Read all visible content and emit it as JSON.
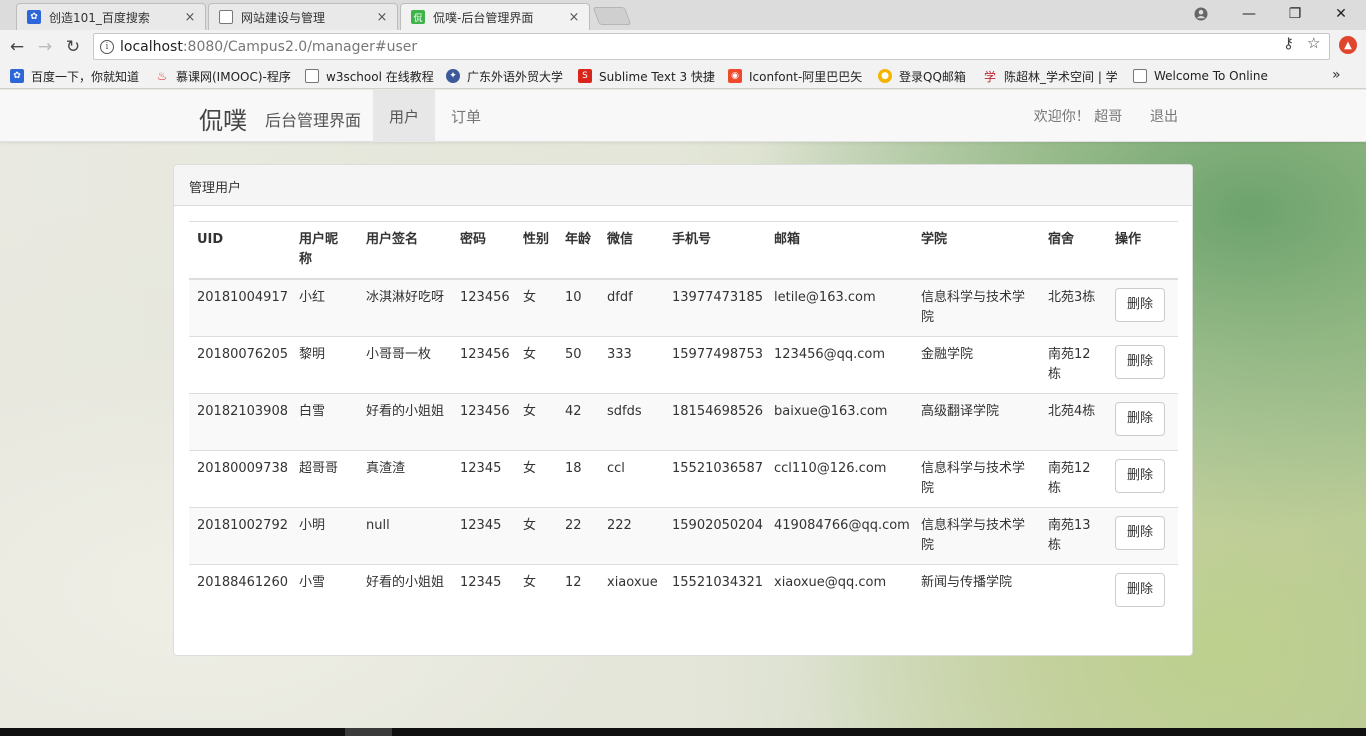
{
  "browser": {
    "tabs": [
      {
        "title": "创造101_百度搜索",
        "icon": "baidu-paw-icon",
        "close": "×"
      },
      {
        "title": "网站建设与管理",
        "icon": "page-icon",
        "close": "×"
      },
      {
        "title": "侃噗-后台管理界面",
        "icon": "site-logo-icon",
        "close": "×"
      }
    ],
    "window_controls": {
      "minimize": "—",
      "maximize": "❐",
      "close": "✕"
    },
    "url_host": "localhost",
    "url_path": ":8080/Campus2.0/manager#user",
    "bookmarks": [
      {
        "label": "百度一下，你就知道",
        "icon": "baidu-paw-icon"
      },
      {
        "label": "慕课网(IMOOC)-程序",
        "icon": "imooc-flame-icon"
      },
      {
        "label": "w3school 在线教程",
        "icon": "page-icon"
      },
      {
        "label": "广东外语外贸大学",
        "icon": "university-seal-icon"
      },
      {
        "label": "Sublime Text 3 快捷",
        "icon": "sublime-icon"
      },
      {
        "label": "Iconfont-阿里巴巴矢",
        "icon": "iconfont-icon"
      },
      {
        "label": "登录QQ邮箱",
        "icon": "qq-mail-icon"
      },
      {
        "label": "陈超林_学术空间 | 学",
        "icon": "academic-icon"
      },
      {
        "label": "Welcome To Online",
        "icon": "page-icon"
      }
    ],
    "bookmarks_more": "»"
  },
  "navbar": {
    "brand": "侃噗",
    "brand_sub": "后台管理界面",
    "items": [
      {
        "label": "用户",
        "active": true
      },
      {
        "label": "订单",
        "active": false
      }
    ],
    "welcome": "欢迎你！ 超哥",
    "logout": "退出"
  },
  "panel": {
    "title": "管理用户",
    "columns": [
      "UID",
      "用户昵称",
      "用户签名",
      "密码",
      "性别",
      "年龄",
      "微信",
      "手机号",
      "邮箱",
      "学院",
      "宿舍",
      "操作"
    ],
    "rows": [
      {
        "uid": "20181004917",
        "nickname": "小红",
        "signature": "冰淇淋好吃呀",
        "password": "123456",
        "gender": "女",
        "age": "10",
        "wechat": "dfdf",
        "phone": "13977473185",
        "email": "letile@163.com",
        "college": "信息科学与技术学院",
        "dorm": "北苑3栋",
        "action": "删除"
      },
      {
        "uid": "20180076205",
        "nickname": "黎明",
        "signature": "小哥哥一枚",
        "password": "123456",
        "gender": "女",
        "age": "50",
        "wechat": "333",
        "phone": "15977498753",
        "email": "123456@qq.com",
        "college": "金融学院",
        "dorm": "南苑12栋",
        "action": "删除"
      },
      {
        "uid": "20182103908",
        "nickname": "白雪",
        "signature": "好看的小姐姐",
        "password": "123456",
        "gender": "女",
        "age": "42",
        "wechat": "sdfds",
        "phone": "18154698526",
        "email": "baixue@163.com",
        "college": "高级翻译学院",
        "dorm": "北苑4栋",
        "action": "删除"
      },
      {
        "uid": "20180009738",
        "nickname": "超哥哥",
        "signature": "真渣渣",
        "password": "12345",
        "gender": "女",
        "age": "18",
        "wechat": "ccl",
        "phone": "15521036587",
        "email": "ccl110@126.com",
        "college": "信息科学与技术学院",
        "dorm": "南苑12栋",
        "action": "删除"
      },
      {
        "uid": "20181002792",
        "nickname": "小明",
        "signature": "null",
        "password": "12345",
        "gender": "女",
        "age": "22",
        "wechat": "222",
        "phone": "15902050204",
        "email": "419084766@qq.com",
        "college": "信息科学与技术学院",
        "dorm": "南苑13栋",
        "action": "删除"
      },
      {
        "uid": "20188461260",
        "nickname": "小雪",
        "signature": "好看的小姐姐",
        "password": "12345",
        "gender": "女",
        "age": "12",
        "wechat": "xiaoxue",
        "phone": "15521034321",
        "email": "xiaoxue@qq.com",
        "college": "新闻与传播学院",
        "dorm": "",
        "action": "删除"
      }
    ]
  }
}
